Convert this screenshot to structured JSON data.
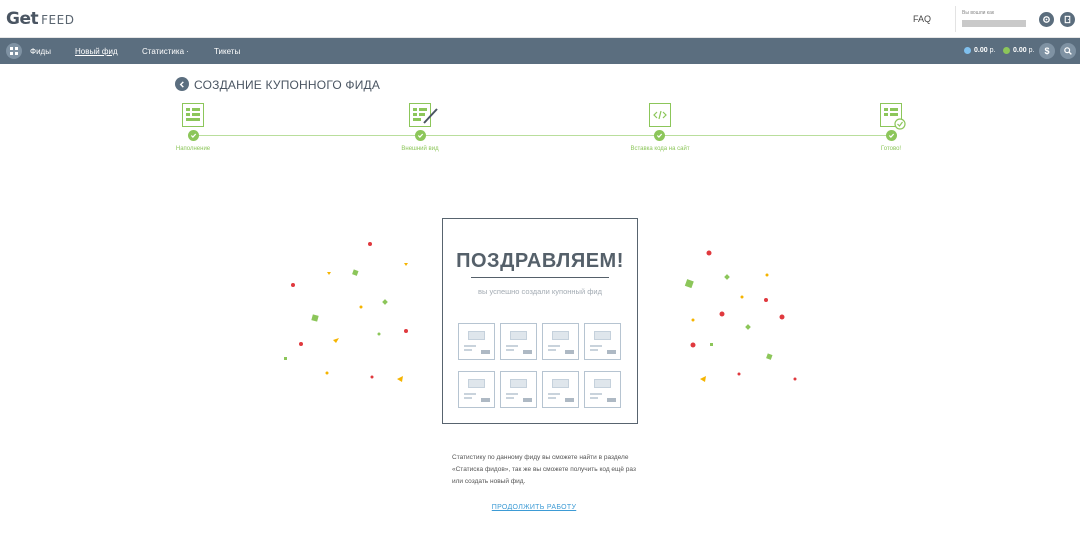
{
  "header": {
    "logo_mark": "Get",
    "logo_word": "FEED",
    "faq": "FAQ",
    "user_label": "Вы вошли как"
  },
  "nav": {
    "items": [
      {
        "label": "Фиды"
      },
      {
        "label": "Новый фид"
      },
      {
        "label": "Статистика ·"
      },
      {
        "label": "Тикеты"
      }
    ],
    "balance1": "0.00",
    "balance2": "0.00",
    "currency": "р.",
    "dollar": "$"
  },
  "page": {
    "title": "СОЗДАНИЕ КУПОННОГО ФИДА"
  },
  "steps": [
    {
      "label": "Наполнение"
    },
    {
      "label": "Внешний вид"
    },
    {
      "label": "Вставка кода на сайт"
    },
    {
      "label": "Готово!"
    }
  ],
  "card": {
    "title": "ПОЗДРАВЛЯЕМ!",
    "subtitle": "вы успешно создали купонный фид"
  },
  "info": {
    "text": "Статистику по данному фиду вы сможете найти в разделе «Статиска фидов», так же вы сможете получить код ещё раз или создать новый фид."
  },
  "continue_label": "ПРОДОЛЖИТЬ РАБОТУ",
  "colors": {
    "nav_bg": "#5b6e7f",
    "accent_green": "#8cc65a",
    "link_blue": "#3d9bd5",
    "confetti_red": "#e0393e",
    "confetti_green": "#8cc65a",
    "confetti_yellow": "#f5b400"
  }
}
